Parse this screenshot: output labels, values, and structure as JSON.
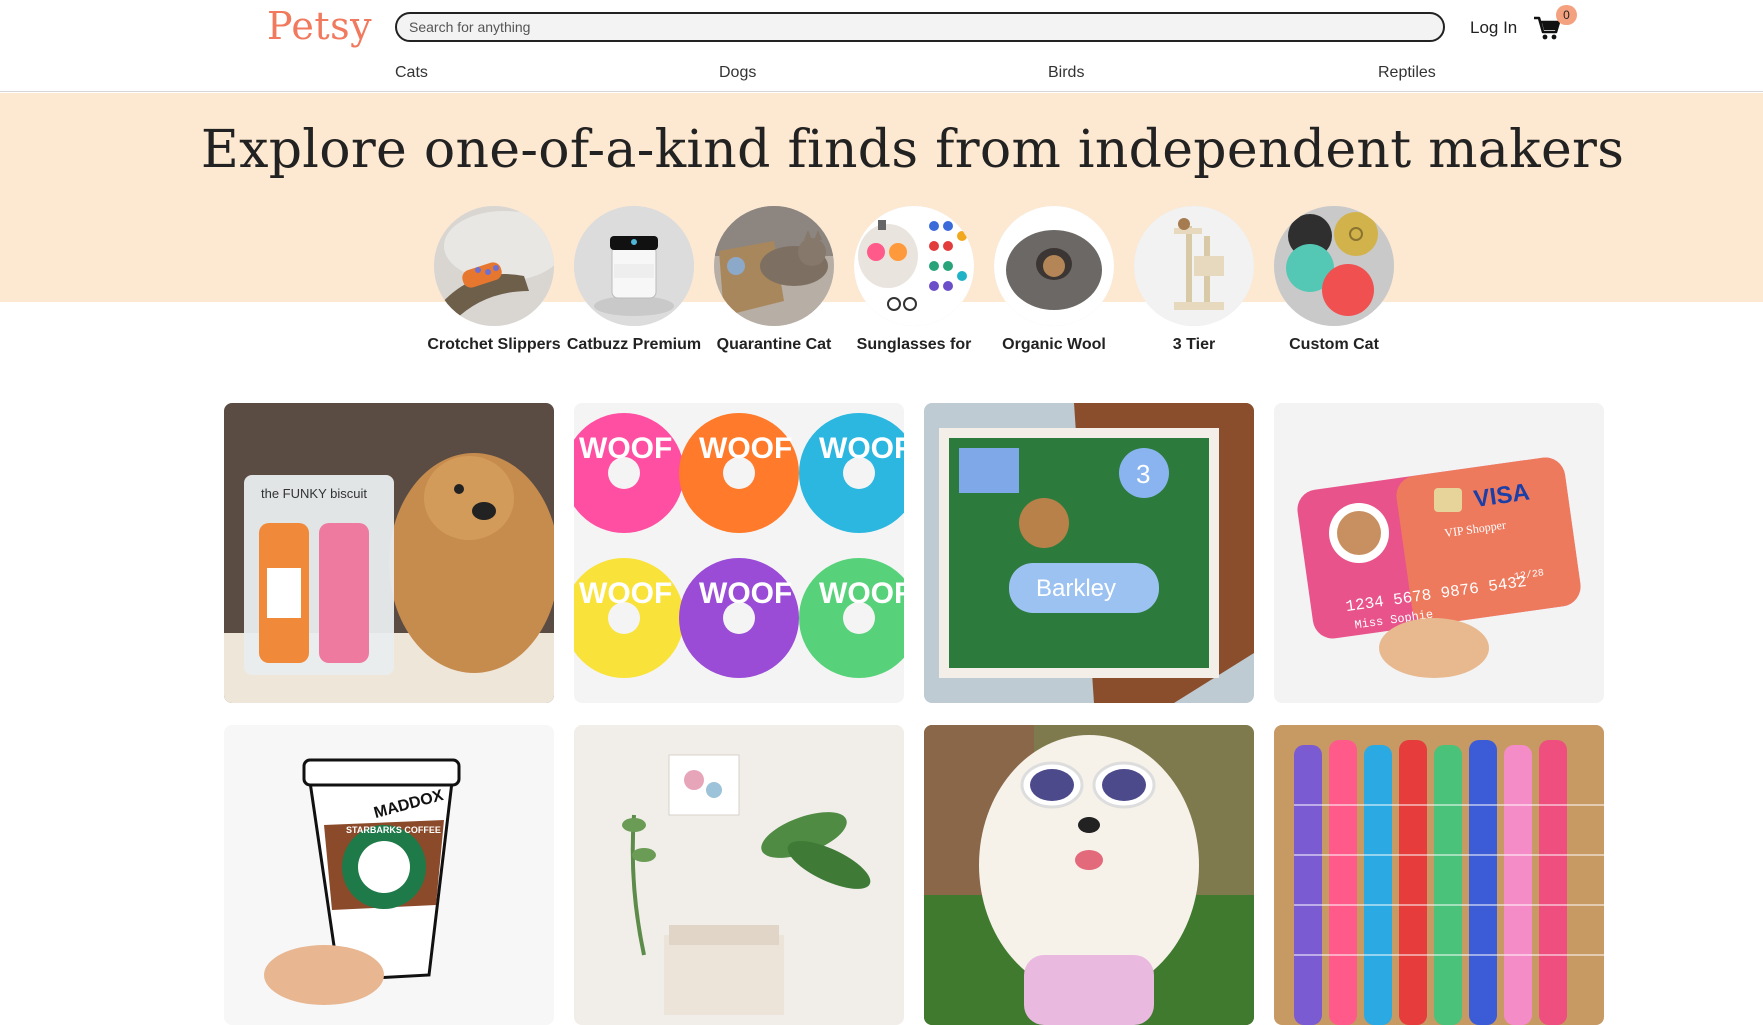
{
  "header": {
    "logo": "Petsy",
    "search_placeholder": "Search for anything",
    "search_value": "",
    "login_label": "Log In",
    "cart_count": "0",
    "logo_color": "#f1795d",
    "badge_color": "#f4a17f"
  },
  "nav": {
    "items": [
      "Cats",
      "Dogs",
      "Birds",
      "Reptiles"
    ]
  },
  "hero": {
    "title": "Explore one-of-a-kind finds from independent makers",
    "background": "#fde9d1",
    "categories": [
      {
        "label": "Crotchet Slippers",
        "image": "cat-slipper-photo"
      },
      {
        "label": "Catbuzz Premium",
        "image": "catnip-jar-photo"
      },
      {
        "label": "Quarantine Cat",
        "image": "cat-in-box-photo"
      },
      {
        "label": "Sunglasses for",
        "image": "cat-sunglasses-photo"
      },
      {
        "label": "Organic Wool",
        "image": "wool-cat-cave-photo"
      },
      {
        "label": "3 Tier",
        "image": "cat-tree-photo"
      },
      {
        "label": "Custom Cat",
        "image": "cat-tags-photo"
      }
    ]
  },
  "products": [
    {
      "name": "funky-biscuit-dog-product",
      "image": "golden-retriever-with-biscuits-photo"
    },
    {
      "name": "woof-donuts-product",
      "image": "woof-donut-treats-photo"
    },
    {
      "name": "barkley-cookie-box-product",
      "image": "birthday-dog-cookies-photo"
    },
    {
      "name": "visa-card-toy-product",
      "image": "credit-card-plush-toy-photo"
    },
    {
      "name": "starbarks-toy-product",
      "image": "starbarks-coffee-plush-photo"
    },
    {
      "name": "interior-product",
      "image": "living-room-plant-photo"
    },
    {
      "name": "dog-sunglasses-product",
      "image": "poodle-goggles-photo"
    },
    {
      "name": "fleece-rope-toys-product",
      "image": "braided-fleece-toys-photo"
    }
  ],
  "product_texts": {
    "biscuit_brand": "the FUNKY biscuit",
    "donut_word": "WOOF",
    "cookie_name": "Barkley",
    "cookie_number": "3",
    "card_brand": "VISA",
    "card_tier": "VIP Shopper",
    "card_number": "1234 5678 9876 5432",
    "card_name": "Miss Sophie",
    "card_expiry": "12/28",
    "cup_name": "MADDOX",
    "cup_brand": "STARBARKS COFFEE"
  }
}
